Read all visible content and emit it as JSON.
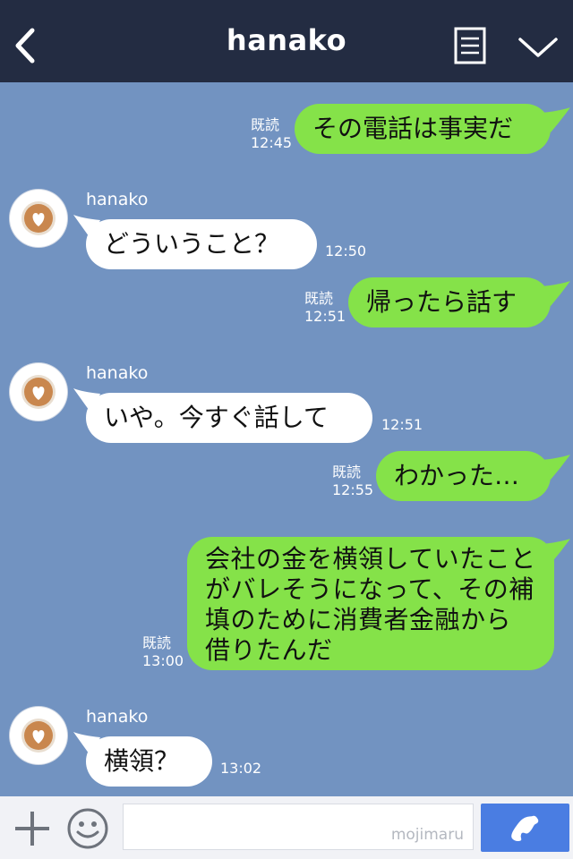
{
  "header": {
    "title": "hanako",
    "colors": {
      "background": "#232c42",
      "text": "#ffffff"
    }
  },
  "chat": {
    "background": "#7293c1",
    "messages": [
      {
        "from": "me",
        "read": "既読",
        "time": "12:45",
        "text": "その電話は事実だ"
      },
      {
        "from": "hanako",
        "sender": "hanako",
        "time": "12:50",
        "text": "どういうこと？"
      },
      {
        "from": "me",
        "read": "既読",
        "time": "12:51",
        "text": "帰ったら話す"
      },
      {
        "from": "hanako",
        "sender": "hanako",
        "time": "12:51",
        "text": "いや。今すぐ話して"
      },
      {
        "from": "me",
        "read": "既読",
        "time": "12:55",
        "text": "わかった…"
      },
      {
        "from": "me",
        "read": "既読",
        "time": "13:00",
        "text": "会社の金を横領していたことがバレそうになって、その補填のために消費者金融から借りたんだ"
      },
      {
        "from": "hanako",
        "sender": "hanako",
        "time": "13:02",
        "text": "横領？"
      }
    ],
    "colors": {
      "my_bubble": "#85e249",
      "their_bubble": "#ffffff"
    }
  },
  "footer": {
    "input_value": "",
    "watermark": "mojimaru",
    "icons": [
      "plus-icon",
      "smiley-icon",
      "phone-icon"
    ]
  }
}
